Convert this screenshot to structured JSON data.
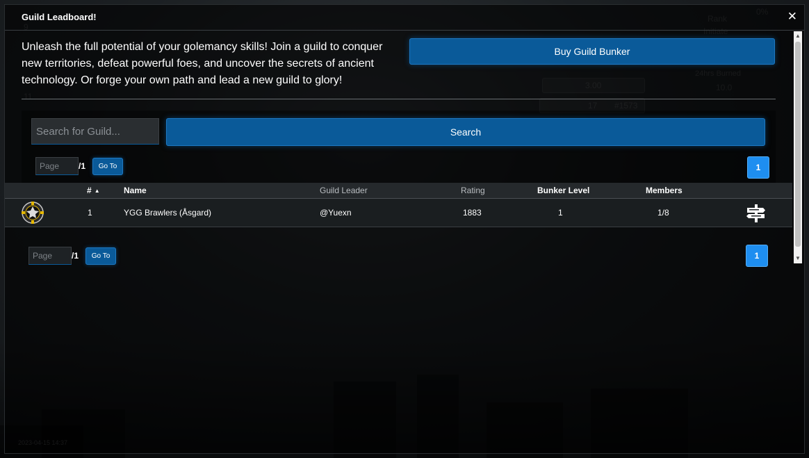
{
  "modal": {
    "title": "Guild Leadboard!",
    "close_icon": "close-icon"
  },
  "intro_text": "Unleash the full potential of your golemancy skills! Join a guild to conquer new territories, defeat powerful foes, and uncover the secrets of ancient technology. Or forge your own path and lead a new guild to glory!",
  "buy_button_label": "Buy Guild Bunker",
  "search": {
    "placeholder": "Search for Guild...",
    "button_label": "Search"
  },
  "pagination_top": {
    "page_placeholder": "Page",
    "total": "/1",
    "goto_label": "Go To",
    "current_page": "1"
  },
  "table": {
    "columns": {
      "rank": "#",
      "name": "Name",
      "leader": "Guild Leader",
      "rating": "Rating",
      "bunker_level": "Bunker Level",
      "members": "Members"
    },
    "rows": [
      {
        "rank": "1",
        "name": "YGG Brawlers (Åsgard)",
        "leader": "@Yuexn",
        "rating": "1883",
        "bunker_level": "1",
        "members": "1/8",
        "emblem_icon": "guild-emblem-icon",
        "action_icon": "signpost-icon"
      }
    ]
  },
  "pagination_bottom": {
    "page_placeholder": "Page",
    "total": "/1",
    "goto_label": "Go To",
    "current_page": "1"
  },
  "background": {
    "rank_label": "Rank",
    "rank_value": "Initiate",
    "percent": "0%",
    "burned_label": "24hrs Burned",
    "burned_value": "10.0",
    "value_a": "3.00",
    "value_b": "17",
    "value_c": "#1573",
    "side_num_a": "9",
    "side_num_b": "11",
    "timestamp": "2023-04-15 14:37"
  },
  "colors": {
    "button_blue": "#0a5a99",
    "page_button_blue": "#1e8ef0"
  }
}
